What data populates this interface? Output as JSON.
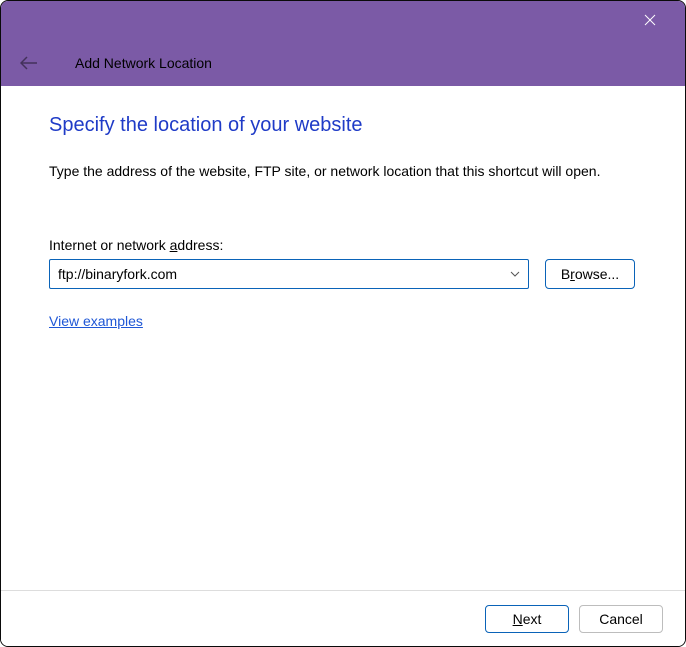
{
  "header": {
    "title": "Add Network Location"
  },
  "page": {
    "title": "Specify the location of your website",
    "instruction": "Type the address of the website, FTP site, or network location that this shortcut will open."
  },
  "field": {
    "label_pre": "Internet or network ",
    "label_u": "a",
    "label_post": "ddress:",
    "value": "ftp://binaryfork.com"
  },
  "buttons": {
    "browse_pre": "B",
    "browse_u": "r",
    "browse_post": "owse...",
    "next_pre": "",
    "next_u": "N",
    "next_post": "ext",
    "cancel": "Cancel"
  },
  "links": {
    "examples": "View examples"
  }
}
